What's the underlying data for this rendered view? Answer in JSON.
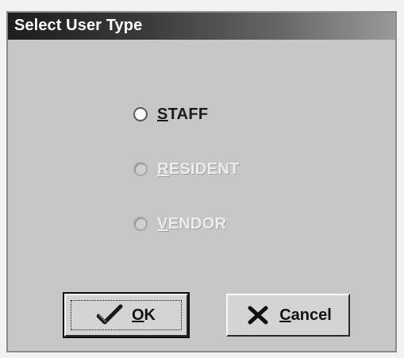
{
  "dialog": {
    "title": "Select User Type"
  },
  "options": [
    {
      "label_key": "S",
      "label_rest": "TAFF",
      "enabled": true
    },
    {
      "label_key": "R",
      "label_rest": "ESIDENT",
      "enabled": false
    },
    {
      "label_key": "V",
      "label_rest": "ENDOR",
      "enabled": false
    }
  ],
  "buttons": {
    "ok": {
      "label_key": "O",
      "label_rest": "K",
      "icon": "check-icon"
    },
    "cancel": {
      "label_key": "C",
      "label_rest": "ancel",
      "icon": "x-icon"
    }
  }
}
